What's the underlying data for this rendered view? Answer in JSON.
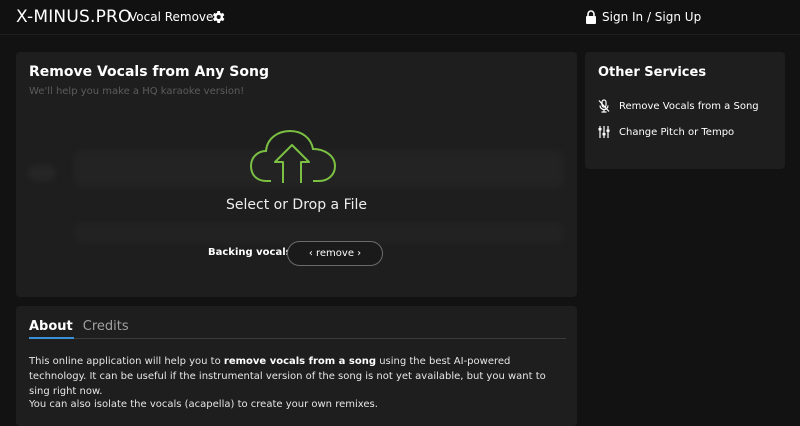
{
  "header": {
    "brand": "X-MINUS.PRO",
    "nav_link": "Vocal Remover",
    "settings_icon": "gear-icon",
    "signin_icon": "lock-icon",
    "signin_label": "Sign In / Sign Up"
  },
  "main": {
    "title": "Remove Vocals from Any Song",
    "subtitle": "We'll help you make a HQ karaoke version!",
    "upload_icon": "cloud-upload-icon",
    "drop_label": "Select or Drop a File",
    "backing_label": "Backing vocals",
    "backing_button": "‹ remove ›"
  },
  "services": {
    "title": "Other Services",
    "items": [
      {
        "label": "Remove Vocals from a Song",
        "icon": "mic-off-icon"
      },
      {
        "label": "Change Pitch or Tempo",
        "icon": "sliders-icon"
      }
    ]
  },
  "about": {
    "tabs": [
      {
        "label": "About",
        "active": true
      },
      {
        "label": "Credits",
        "active": false
      }
    ],
    "para1_before": "This online application will help you to ",
    "para1_bold": "remove vocals from a song",
    "para1_after": " using the best AI-powered technology. It can be useful if the instrumental version of the song is not yet available, but you want to sing right now.",
    "para2": "You can also isolate the vocals (acapella) to create your own remixes."
  },
  "colors": {
    "background": "#121212",
    "panel": "#1e1e1e",
    "accent_green": "#7bc043",
    "tab_underline": "#3b8fd6"
  }
}
